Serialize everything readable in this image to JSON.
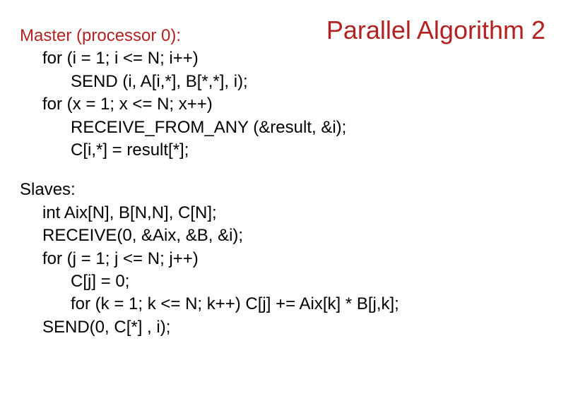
{
  "title": "Parallel Algorithm 2",
  "master": {
    "label": "Master (processor 0):",
    "line1": "for (i = 1; i <= N; i++)",
    "line2": "SEND (i, A[i,*], B[*,*], i);",
    "line3": "for (x = 1; x <= N; x++)",
    "line4": "RECEIVE_FROM_ANY (&result, &i);",
    "line5": "C[i,*] = result[*];"
  },
  "slaves": {
    "label": "Slaves:",
    "line1": "int Aix[N], B[N,N], C[N];",
    "line2": "RECEIVE(0, &Aix, &B, &i);",
    "line3": "for (j = 1; j <= N; j++)",
    "line4": "C[j] = 0;",
    "line5": "for (k = 1; k <= N; k++) C[j] += Aix[k] * B[j,k];",
    "line6": "SEND(0, C[*] , i);"
  }
}
